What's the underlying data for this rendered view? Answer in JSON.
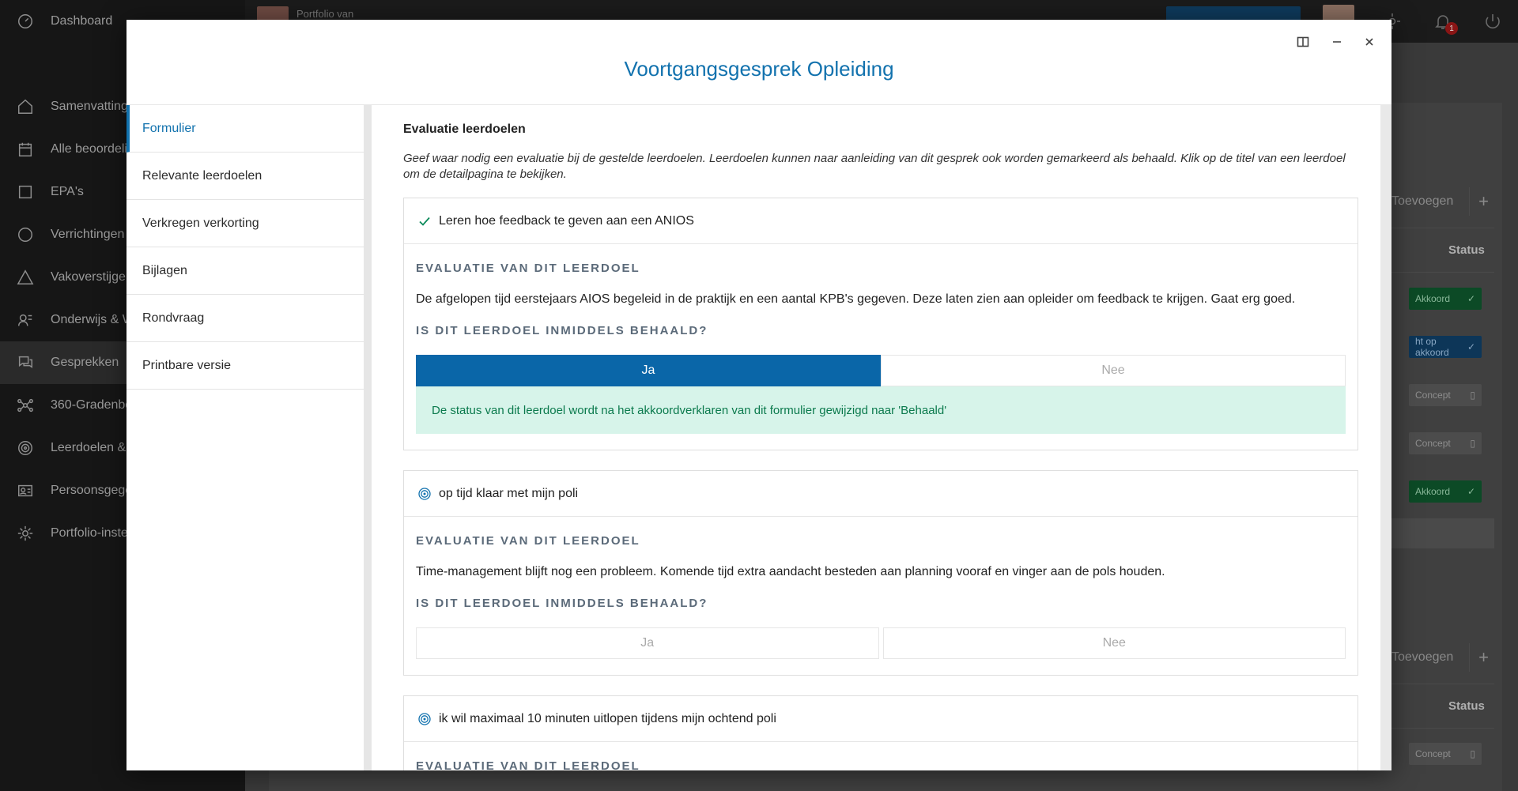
{
  "sidebar": {
    "items": [
      {
        "label": "Dashboard",
        "icon": "dashboard-icon"
      },
      {
        "label": "Samenvatting",
        "icon": "home-icon"
      },
      {
        "label": "Alle beoordeli",
        "icon": "calendar-icon"
      },
      {
        "label": "EPA's",
        "icon": "square-icon"
      },
      {
        "label": "Verrichtingen",
        "icon": "circle-icon"
      },
      {
        "label": "Vakoverstijgen",
        "icon": "triangle-icon"
      },
      {
        "label": "Onderwijs & W",
        "icon": "education-icon"
      },
      {
        "label": "Gesprekken",
        "icon": "chat-icon"
      },
      {
        "label": "360-Gradenbe",
        "icon": "network-icon"
      },
      {
        "label": "Leerdoelen & C",
        "icon": "target-icon"
      },
      {
        "label": "Persoonsgege",
        "icon": "id-card-icon"
      },
      {
        "label": "Portfolio-inste",
        "icon": "gear-icon"
      }
    ]
  },
  "topbar": {
    "portfolio_label": "Portfolio van",
    "notification_count": "1"
  },
  "background": {
    "toevoegen": "Toevoegen",
    "status_header": "Status",
    "badges": [
      "Akkoord",
      "ht op akkoord",
      "Concept",
      "Concept",
      "Akkoord",
      "Concept"
    ]
  },
  "modal": {
    "title": "Voortgangsgesprek Opleiding",
    "nav": [
      "Formulier",
      "Relevante leerdoelen",
      "Verkregen verkorting",
      "Bijlagen",
      "Rondvraag",
      "Printbare versie"
    ],
    "section_title": "Evaluatie leerdoelen",
    "section_desc": "Geef waar nodig een evaluatie bij de gestelde leerdoelen. Leerdoelen kunnen naar aanleiding van dit gesprek ook worden gemarkeerd als behaald. Klik op de titel van een leerdoel om de detailpagina te bekijken.",
    "goals": [
      {
        "title": "Leren hoe feedback te geven aan een ANIOS",
        "icon": "check-icon",
        "eval_label": "EVALUATIE VAN DIT LEERDOEL",
        "eval_text": "De afgelopen tijd eerstejaars AIOS begeleid in de praktijk en een aantal KPB's gegeven. Deze laten zien aan opleider om feedback te krijgen. Gaat erg goed.",
        "question": "IS DIT LEERDOEL INMIDDELS BEHAALD?",
        "yes": "Ja",
        "no": "Nee",
        "selected": "Ja",
        "info": "De status van dit leerdoel wordt na het akkoordverklaren van dit formulier gewijzigd naar 'Behaald'"
      },
      {
        "title": "op tijd klaar met mijn poli",
        "icon": "target-icon",
        "eval_label": "EVALUATIE VAN DIT LEERDOEL",
        "eval_text": "Time-management blijft nog een probleem. Komende tijd extra aandacht besteden aan planning vooraf en vinger aan de pols houden.",
        "question": "IS DIT LEERDOEL INMIDDELS BEHAALD?",
        "yes": "Ja",
        "no": "Nee"
      },
      {
        "title": "ik wil maximaal 10 minuten uitlopen tijdens mijn ochtend poli",
        "icon": "target-icon",
        "eval_label": "EVALUATIE VAN DIT LEERDOEL"
      }
    ]
  },
  "colors": {
    "accent": "#1272ae",
    "selected": "#0a66a8",
    "success_bg": "#d7f4ea",
    "success_text": "#0b7a4d"
  }
}
